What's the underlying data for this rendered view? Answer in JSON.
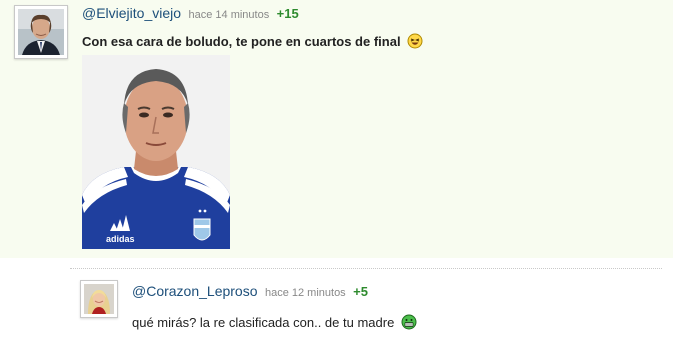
{
  "comments": [
    {
      "username": "@Elviejito_viejo",
      "timestamp": "hace 14 minutos",
      "score": "+15",
      "text": "Con esa cara de boludo, te pone en cuartos de final",
      "emoji": "laughing-emoji",
      "image": "photo-man-blue-jersey"
    },
    {
      "username": "@Corazon_Leproso",
      "timestamp": "hace 12 minutos",
      "score": "+5",
      "text": "qué mirás? la re clasificada con.. de tu madre",
      "emoji": "grinning-green-emoji"
    }
  ],
  "colors": {
    "username": "#1d4f7a",
    "score": "#2e8b2e",
    "timestamp": "#888888",
    "highlight_bg": "#f8fcf0"
  }
}
